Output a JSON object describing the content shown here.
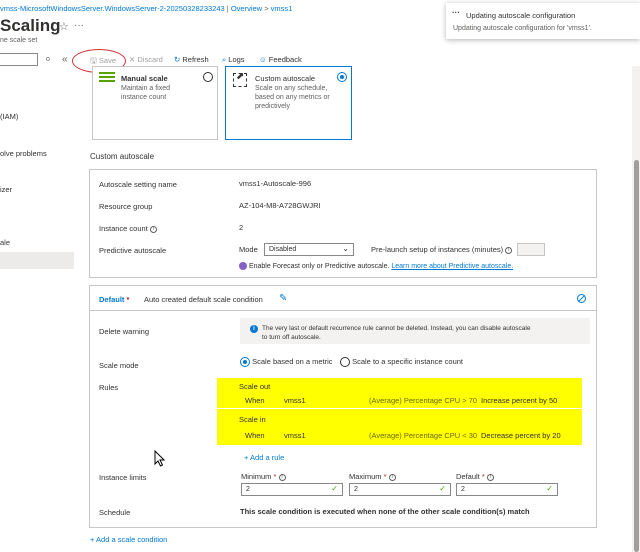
{
  "breadcrumb": {
    "resource": "vmss-MicrosoftWindowsServer.WindowsServer-2-20250328233243",
    "sep1": "|",
    "section": "Overview",
    "sep2": ">",
    "current": "vmss1"
  },
  "page": {
    "title": "Scaling",
    "subtitle": "ne scale set"
  },
  "sidebar": {
    "collapse_glyph": "«",
    "search_suffix": "o",
    "items": [
      "(IAM)",
      "olve problems",
      "izer",
      "ale"
    ]
  },
  "toolbar": {
    "save": "Save",
    "discard": "Discard",
    "refresh": "Refresh",
    "logs": "Logs",
    "feedback": "Feedback"
  },
  "notification": {
    "title": "Updating autoscale configuration",
    "message": "Updating autoscale configuration for 'vmss1'."
  },
  "options": {
    "manual": {
      "title": "Manual scale",
      "desc_lines": [
        "Maintain a fixed",
        "instance count"
      ]
    },
    "custom": {
      "title": "Custom autoscale",
      "desc_lines": [
        "Scale on any schedule,",
        "based on any metrics or",
        "predictively"
      ]
    }
  },
  "section_title": "Custom autoscale",
  "settings": {
    "name_label": "Autoscale setting name",
    "name_value": "vmss1-Autoscale-996",
    "rg_label": "Resource group",
    "rg_value": "AZ-104-M8-A728GWJRI",
    "count_label": "Instance count",
    "count_value": "2",
    "predictive_label": "Predictive autoscale",
    "mode_label": "Mode",
    "mode_value": "Disabled",
    "prelaunch_label": "Pre-launch setup of instances (minutes)",
    "forecast_text": "Enable Forecast only or Predictive autoscale.",
    "forecast_link": "Learn more about Predictive autoscale."
  },
  "condition": {
    "title": "Default",
    "required": "*",
    "desc": "Auto created default scale condition",
    "delete_label": "Delete warning",
    "delete_msg_lines": [
      "The very last or default recurrence rule cannot be deleted. Instead, you can disable autoscale",
      "to turn off autoscale."
    ],
    "scale_mode_label": "Scale mode",
    "scale_metric": "Scale based on a metric",
    "scale_specific": "Scale to a specific instance count",
    "rules_label": "Rules",
    "scale_out": {
      "heading": "Scale out",
      "when": "When",
      "resource": "vmss1",
      "metric": "(Average) Percentage CPU > 70",
      "action": "Increase percent by 50"
    },
    "scale_in": {
      "heading": "Scale in",
      "when": "When",
      "resource": "vmss1",
      "metric": "(Average) Percentage CPU < 30",
      "action": "Decrease percent by 20"
    },
    "add_rule": "+ Add a rule",
    "limits_label": "Instance limits",
    "minimum_label": "Minimum",
    "minimum_value": "2",
    "maximum_label": "Maximum",
    "maximum_value": "2",
    "default_label": "Default",
    "default_value": "2",
    "schedule_label": "Schedule",
    "schedule_text": "This scale condition is executed when none of the other scale condition(s) match"
  },
  "add_condition": "+ Add a scale condition",
  "colors": {
    "accent": "#0078d4",
    "highlight": "#ffff00",
    "annotation": "#d13438"
  }
}
